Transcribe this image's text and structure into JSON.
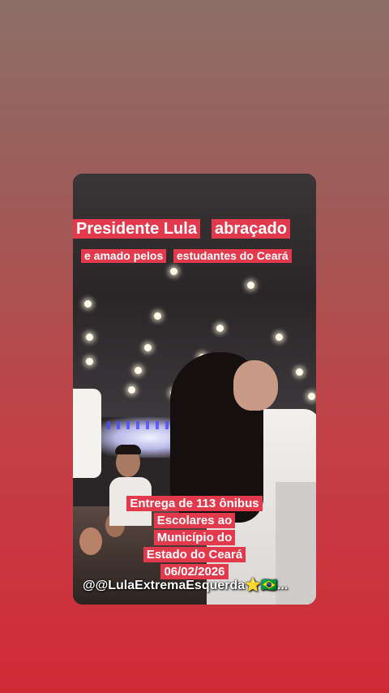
{
  "caption": {
    "line1_part1": "Presidente Lula",
    "line1_part2": "abraçado",
    "line2_part1": "e amado pelos",
    "line2_part2": "estudantes do Ceará"
  },
  "event": {
    "lines": [
      "Entrega de 113 ônibus",
      "Escolares ao",
      "Município do",
      "Estado do Ceará",
      "06/02/2026"
    ]
  },
  "watermark": {
    "text": "@@LulaExtremaEsquerda⭐🇧🇷..."
  },
  "colors": {
    "caption_bg": "#e23a4c",
    "background_top": "#8c6f68",
    "background_bottom": "#d12a37"
  }
}
